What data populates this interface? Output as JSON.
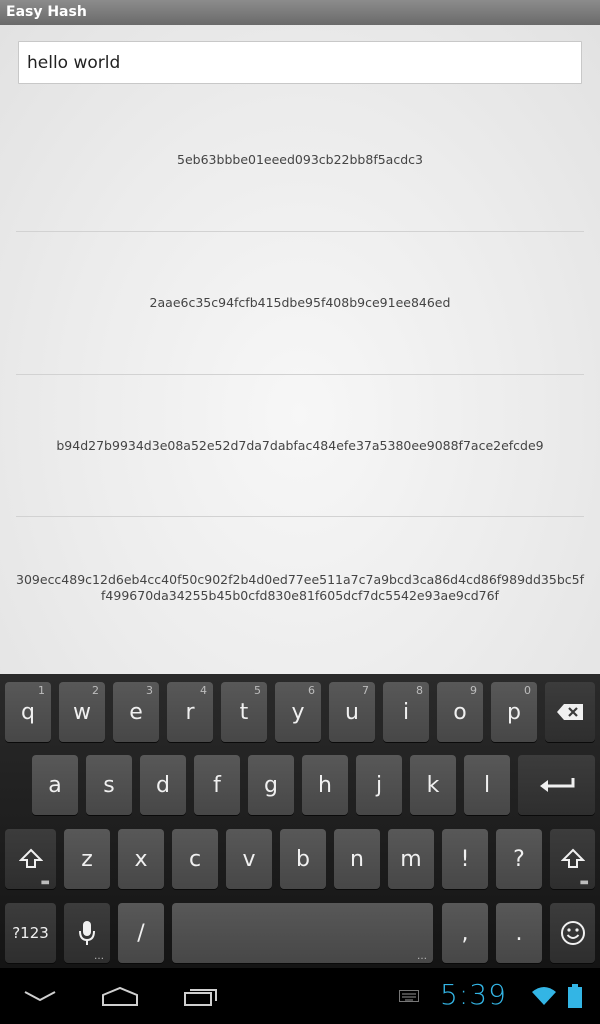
{
  "app": {
    "title": "Easy Hash"
  },
  "input": {
    "value": "hello world"
  },
  "hashes": [
    "5eb63bbbe01eeed093cb22bb8f5acdc3",
    "2aae6c35c94fcfb415dbe95f408b9ce91ee846ed",
    "b94d27b9934d3e08a52e52d7da7dabfac484efe37a5380ee9088f7ace2efcde9",
    "309ecc489c12d6eb4cc40f50c902f2b4d0ed77ee511a7c7a9bcd3ca86d4cd86f989dd35bc5ff499670da34255b45b0cfd830e81f605dcf7dc5542e93ae9cd76f"
  ],
  "keyboard": {
    "row1": [
      {
        "label": "q",
        "hint": "1"
      },
      {
        "label": "w",
        "hint": "2"
      },
      {
        "label": "e",
        "hint": "3"
      },
      {
        "label": "r",
        "hint": "4"
      },
      {
        "label": "t",
        "hint": "5"
      },
      {
        "label": "y",
        "hint": "6"
      },
      {
        "label": "u",
        "hint": "7"
      },
      {
        "label": "i",
        "hint": "8"
      },
      {
        "label": "o",
        "hint": "9"
      },
      {
        "label": "p",
        "hint": "0"
      }
    ],
    "row2": [
      "a",
      "s",
      "d",
      "f",
      "g",
      "h",
      "j",
      "k",
      "l"
    ],
    "row3": [
      "z",
      "x",
      "c",
      "v",
      "b",
      "n",
      "m",
      "!",
      "?"
    ],
    "symbols_label": "?123",
    "slash_label": "/",
    "comma_label": ",",
    "period_label": "."
  },
  "status": {
    "time": "5:39"
  },
  "colors": {
    "accent": "#33b5e5",
    "titlebar": "#7a7a7a"
  }
}
